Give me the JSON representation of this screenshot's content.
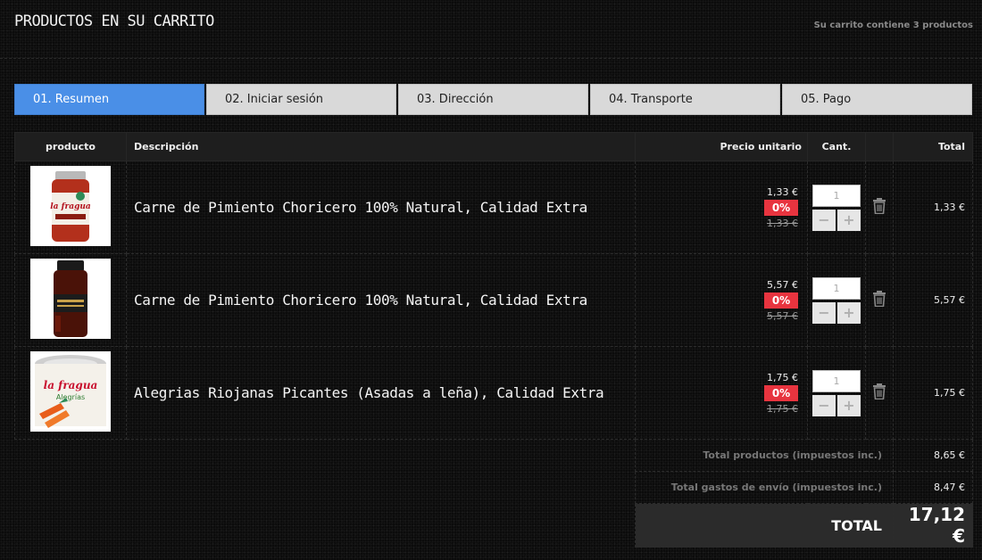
{
  "header": {
    "title": "PRODUCTOS EN SU CARRITO",
    "summary": "Su carrito contiene 3 productos"
  },
  "steps": [
    {
      "label": "01. Resumen",
      "active": true
    },
    {
      "label": "02. Iniciar sesión"
    },
    {
      "label": "03. Dirección"
    },
    {
      "label": "04. Transporte"
    },
    {
      "label": "05. Pago"
    }
  ],
  "table": {
    "headers": {
      "product": "producto",
      "description": "Descripción",
      "unit_price": "Precio unitario",
      "qty": "Cant.",
      "total": "Total"
    }
  },
  "items": [
    {
      "name": "Carne de Pimiento Choricero 100% Natural, Calidad Extra",
      "price": "1,33 €",
      "discount": "0%",
      "old_price": "1,33 €",
      "qty": "1",
      "total": "1,33 €",
      "image": "jar-red-pepper-paste",
      "image_text": "la fragua"
    },
    {
      "name": "Carne de Pimiento Choricero 100% Natural, Calidad Extra",
      "price": "5,57 €",
      "discount": "0%",
      "old_price": "5,57 €",
      "qty": "1",
      "total": "5,57 €",
      "image": "jar-dark-pepper-paste"
    },
    {
      "name": "Alegrias Riojanas Picantes (Asadas a leña), Calidad Extra",
      "price": "1,75 €",
      "discount": "0%",
      "old_price": "1,75 €",
      "qty": "1",
      "total": "1,75 €",
      "image": "can-alegrias-riojanas",
      "image_text": "la fragua",
      "image_subtext": "Alegrías"
    }
  ],
  "qty_controls": {
    "minus": "−",
    "plus": "+"
  },
  "totals": {
    "products_label": "Total productos (impuestos inc.)",
    "products_value": "8,65 €",
    "shipping_label": "Total gastos de envío (impuestos inc.)",
    "shipping_value": "8,47 €",
    "grand_label": "TOTAL",
    "grand_value": "17,12 €"
  },
  "colors": {
    "active_step": "#4a8fe7",
    "discount_badge": "#e8343f",
    "background": "#0b0b0b"
  }
}
